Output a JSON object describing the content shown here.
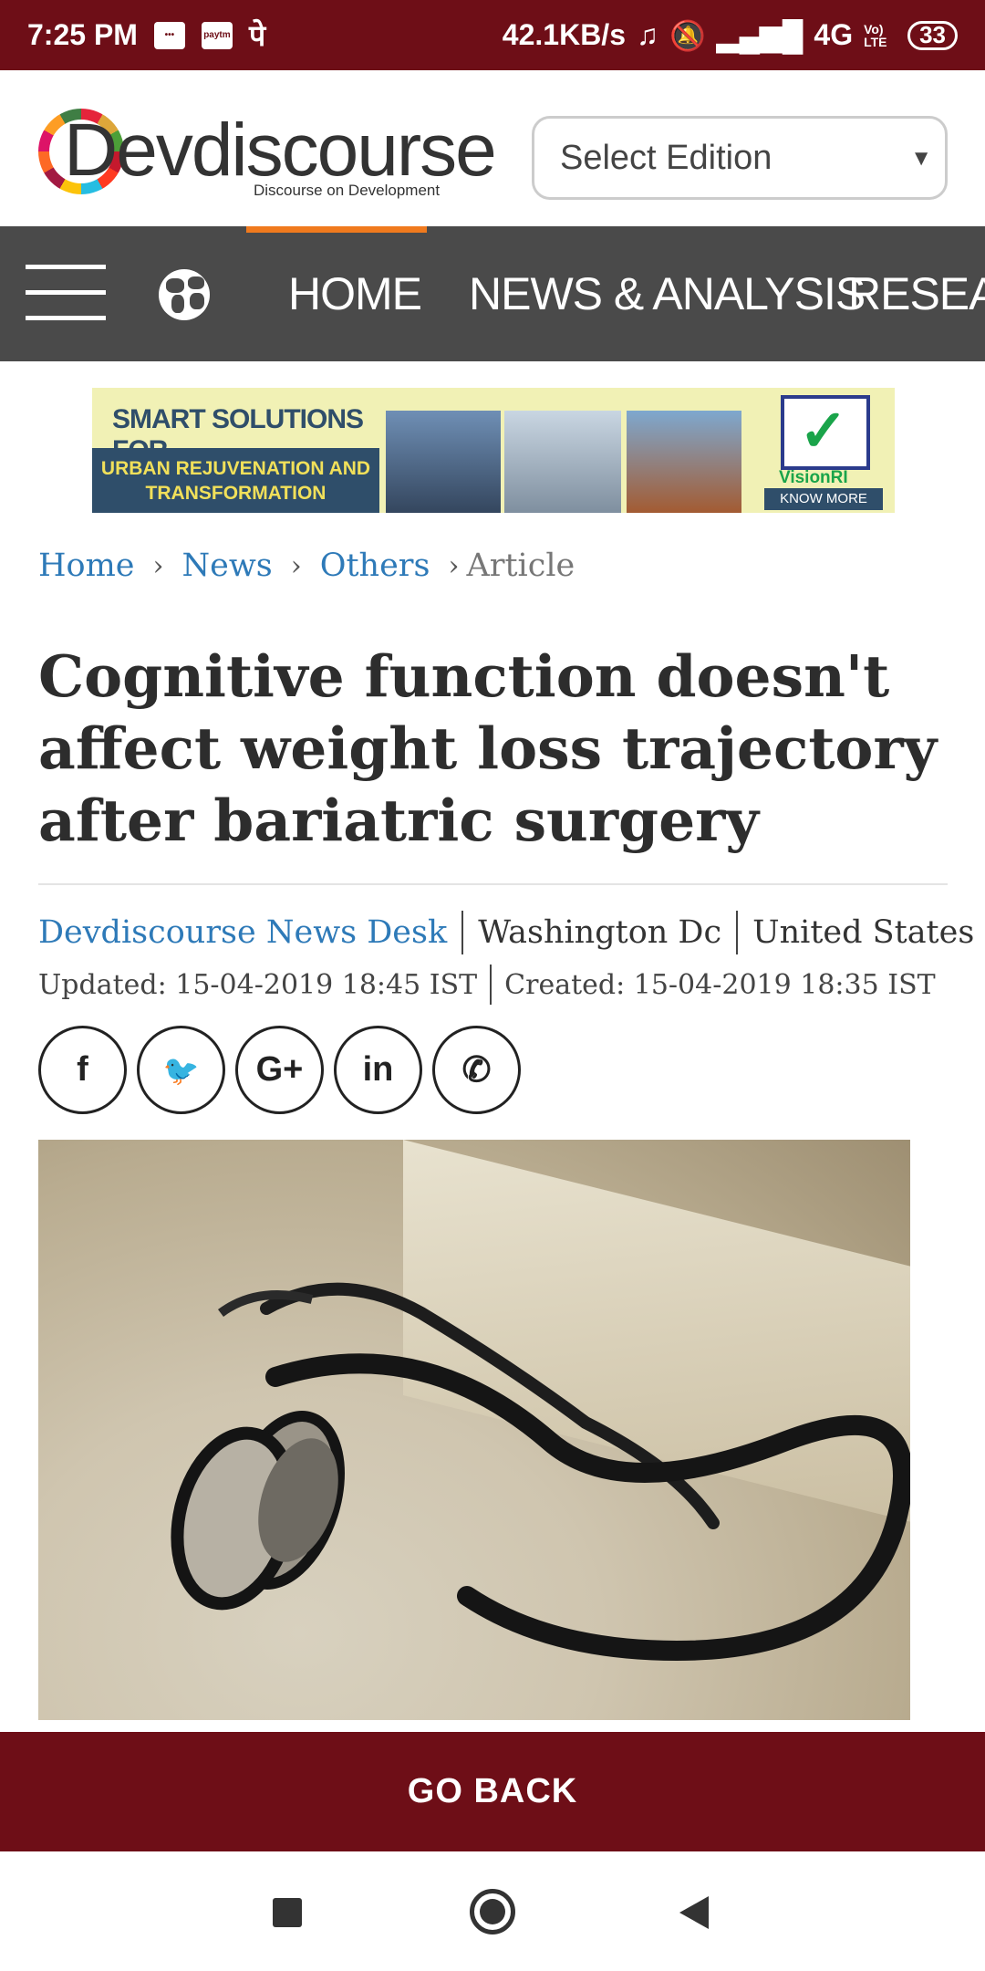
{
  "status_bar": {
    "time": "7:25 PM",
    "hindi_glyph": "पे",
    "paytm": "paytm",
    "net_speed": "42.1KB/s",
    "network": "4G",
    "volte": "Vo) LTE",
    "battery": "33"
  },
  "header": {
    "logo_text": "Devdiscourse",
    "logo_tagline": "Discourse on Development",
    "edition_select": {
      "value": "Select Edition",
      "options": [
        "Select Edition"
      ]
    }
  },
  "nav": {
    "menu_icon": "hamburger-icon",
    "globe_icon": "globe-icon",
    "items": [
      {
        "label": "HOME",
        "active": true
      },
      {
        "label": "NEWS & ANALYSIS",
        "active": false
      },
      {
        "label": "RESEA",
        "active": false
      }
    ],
    "active_color": "#f07a1e"
  },
  "ad": {
    "line1": "SMART SOLUTIONS FOR",
    "line2": "URBAN REJUVENATION AND TRANSFORMATION",
    "brand": "VisionRI",
    "cta": "KNOW MORE"
  },
  "breadcrumb": {
    "items": [
      "Home",
      "News",
      "Others"
    ],
    "current": "Article",
    "separator": "›"
  },
  "article": {
    "title": "Cognitive function doesn't affect weight loss trajectory after bariatric surgery",
    "author": "Devdiscourse News Desk",
    "city": "Washington Dc",
    "country": "United States",
    "updated": "Updated: 15-04-2019 18:45 IST",
    "created": "Created: 15-04-2019 18:35 IST"
  },
  "share": [
    {
      "glyph": "f",
      "icon": "facebook-icon"
    },
    {
      "glyph": "🐦",
      "icon": "twitter-icon"
    },
    {
      "glyph": "G+",
      "icon": "google-plus-icon"
    },
    {
      "glyph": "in",
      "icon": "linkedin-icon"
    },
    {
      "glyph": "✆",
      "icon": "whatsapp-icon"
    }
  ],
  "go_back": "GO BACK",
  "colors": {
    "brand_maroon": "#6e0e17",
    "nav_gray": "#4a4a4a",
    "link_blue": "#2e7ab8"
  }
}
